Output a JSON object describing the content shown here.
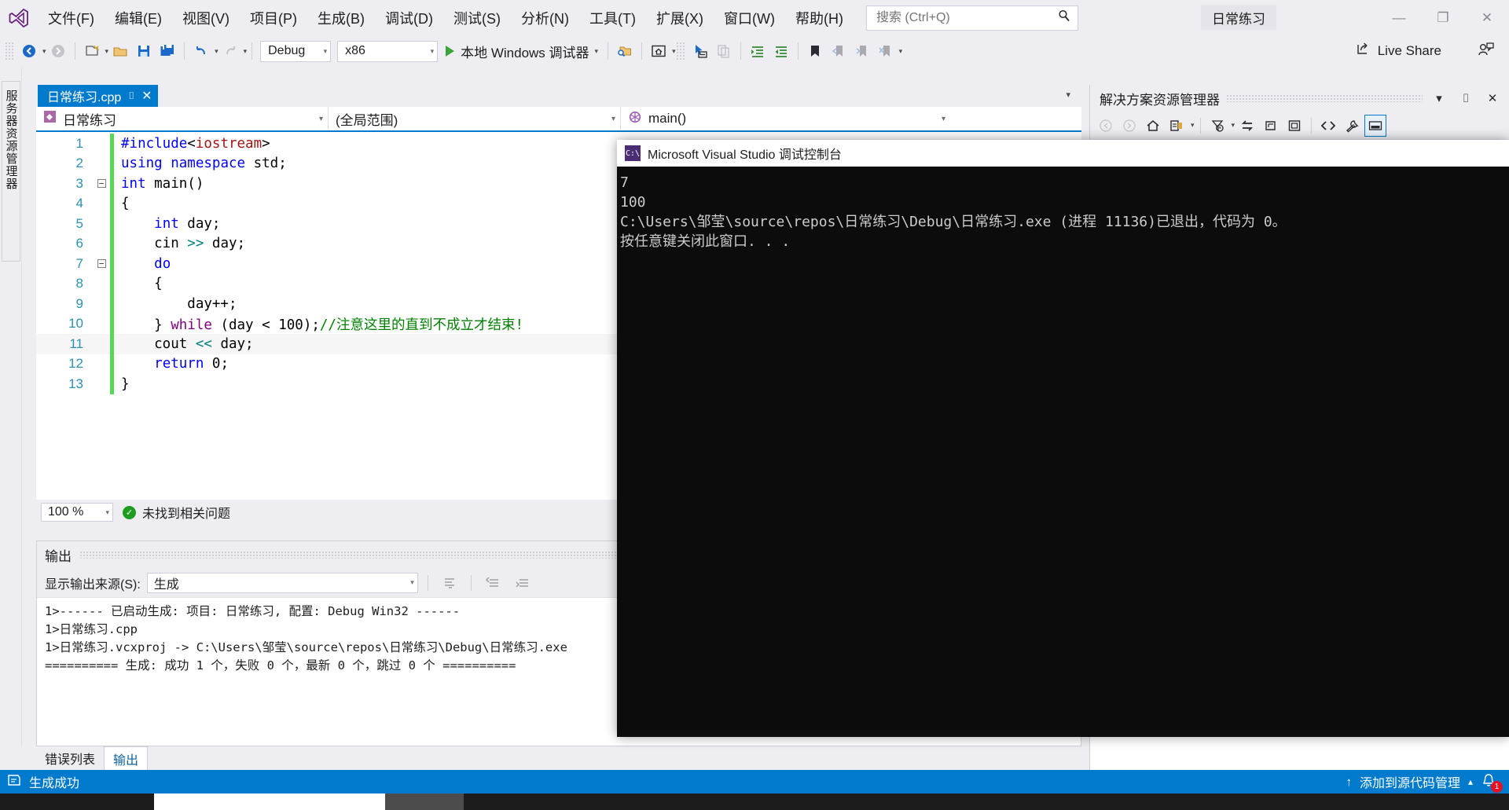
{
  "titlebar": {
    "logo_icon": "visual-studio-logo",
    "menus": [
      {
        "label": "文件(F)"
      },
      {
        "label": "编辑(E)"
      },
      {
        "label": "视图(V)"
      },
      {
        "label": "项目(P)"
      },
      {
        "label": "生成(B)"
      },
      {
        "label": "调试(D)"
      },
      {
        "label": "测试(S)"
      },
      {
        "label": "分析(N)"
      },
      {
        "label": "工具(T)"
      },
      {
        "label": "扩展(X)"
      },
      {
        "label": "窗口(W)"
      },
      {
        "label": "帮助(H)"
      }
    ],
    "search_placeholder": "搜索 (Ctrl+Q)",
    "search_value": "",
    "search_icon": "search-icon",
    "project_title": "日常练习",
    "minimize": "—",
    "maximize": "❐",
    "close": "✕"
  },
  "toolbar": {
    "nav_back_icon": "navigate-back-icon",
    "nav_forward_icon": "navigate-forward-icon",
    "new_project_icon": "new-project-icon",
    "open_file_icon": "open-file-icon",
    "save_icon": "save-icon",
    "save_all_icon": "save-all-icon",
    "undo_icon": "undo-icon",
    "redo_icon": "redo-icon",
    "configuration": "Debug",
    "platform": "x86",
    "run_label": "本地 Windows 调试器",
    "run_icon": "play-icon",
    "find_in_files_icon": "find-in-files-icon",
    "home_icon": "home-window-icon",
    "select_icon": "pointer-select-icon",
    "copy_icon": "copy-icon",
    "indent_icon": "increase-indent-icon",
    "outdent_icon": "decrease-indent-icon",
    "bookmark_icon": "bookmark-icon",
    "prev_bookmark_icon": "previous-bookmark-icon",
    "next_bookmark_icon": "next-bookmark-icon",
    "clear_bookmark_icon": "clear-bookmark-icon",
    "live_share_label": "Live Share",
    "live_share_icon": "share-icon",
    "feedback_icon": "feedback-person-icon"
  },
  "left_rail": {
    "server_explorer_label": "服务器资源管理器"
  },
  "editor": {
    "tab_name": "日常练习.cpp",
    "tab_pin_icon": "pin-icon",
    "tab_close_icon": "close-icon",
    "tabstrip_caret_icon": "chevron-down-icon",
    "nav_project": "日常练习",
    "nav_project_icon": "cpp-project-icon",
    "nav_scope": "(全局范围)",
    "nav_function": "main()",
    "nav_function_icon": "method-icon",
    "zoom_level": "100 %",
    "issue_status": "未找到相关问题",
    "issue_icon": "check-circle-icon",
    "lines": [
      {
        "n": "1",
        "fold": "",
        "changed": true,
        "tokens": [
          {
            "t": "#include",
            "c": "k-blue"
          },
          {
            "t": "<",
            "c": "k-plain"
          },
          {
            "t": "iostream",
            "c": "k-red"
          },
          {
            "t": ">",
            "c": "k-plain"
          }
        ]
      },
      {
        "n": "2",
        "fold": "",
        "changed": true,
        "tokens": [
          {
            "t": "using",
            "c": "k-blue"
          },
          {
            "t": " ",
            "c": "k-plain"
          },
          {
            "t": "namespace",
            "c": "k-blue"
          },
          {
            "t": " std;",
            "c": "k-plain"
          }
        ]
      },
      {
        "n": "3",
        "fold": "−",
        "changed": true,
        "tokens": [
          {
            "t": "int",
            "c": "k-blue"
          },
          {
            "t": " main()",
            "c": "k-plain"
          }
        ]
      },
      {
        "n": "4",
        "fold": "",
        "changed": true,
        "tokens": [
          {
            "t": "{",
            "c": "k-plain"
          }
        ]
      },
      {
        "n": "5",
        "fold": "",
        "changed": true,
        "tokens": [
          {
            "t": "    ",
            "c": "k-plain"
          },
          {
            "t": "int",
            "c": "k-blue"
          },
          {
            "t": " day;",
            "c": "k-plain"
          }
        ]
      },
      {
        "n": "6",
        "fold": "",
        "changed": true,
        "tokens": [
          {
            "t": "    cin ",
            "c": "k-plain"
          },
          {
            "t": ">>",
            "c": "k-op"
          },
          {
            "t": " day;",
            "c": "k-plain"
          }
        ]
      },
      {
        "n": "7",
        "fold": "−",
        "changed": true,
        "tokens": [
          {
            "t": "    ",
            "c": "k-plain"
          },
          {
            "t": "do",
            "c": "k-blue"
          }
        ]
      },
      {
        "n": "8",
        "fold": "",
        "changed": true,
        "tokens": [
          {
            "t": "    {",
            "c": "k-plain"
          }
        ]
      },
      {
        "n": "9",
        "fold": "",
        "changed": true,
        "tokens": [
          {
            "t": "        day++;",
            "c": "k-plain"
          }
        ]
      },
      {
        "n": "10",
        "fold": "",
        "changed": true,
        "tokens": [
          {
            "t": "    } ",
            "c": "k-plain"
          },
          {
            "t": "while",
            "c": "k-purple"
          },
          {
            "t": " (day ",
            "c": "k-plain"
          },
          {
            "t": "<",
            "c": "k-plain"
          },
          {
            "t": " 100);",
            "c": "k-plain"
          },
          {
            "t": "//注意这里的直到不成立才结束!",
            "c": "k-green"
          }
        ]
      },
      {
        "n": "11",
        "fold": "",
        "changed": true,
        "current": true,
        "tokens": [
          {
            "t": "    cout ",
            "c": "k-plain"
          },
          {
            "t": "<<",
            "c": "k-op"
          },
          {
            "t": " day;",
            "c": "k-plain"
          }
        ]
      },
      {
        "n": "12",
        "fold": "",
        "changed": true,
        "tokens": [
          {
            "t": "    ",
            "c": "k-plain"
          },
          {
            "t": "return",
            "c": "k-blue"
          },
          {
            "t": " 0;",
            "c": "k-plain"
          }
        ]
      },
      {
        "n": "13",
        "fold": "",
        "changed": true,
        "tokens": [
          {
            "t": "}",
            "c": "k-plain"
          }
        ]
      }
    ]
  },
  "output": {
    "pane_title": "输出",
    "source_label": "显示输出来源(S):",
    "source_value": "生成",
    "find_icon": "find-message-icon",
    "go_to_prev_icon": "go-to-previous-message-icon",
    "go_to_next_icon": "go-to-next-message-icon",
    "lines": [
      "1>------ 已启动生成: 项目: 日常练习, 配置: Debug Win32 ------",
      "1>日常练习.cpp",
      "1>日常练习.vcxproj -> C:\\Users\\邹莹\\source\\repos\\日常练习\\Debug\\日常练习.exe",
      "========== 生成: 成功 1 个，失败 0 个，最新 0 个，跳过 0 个 =========="
    ]
  },
  "bottom_tabs": [
    {
      "label": "错误列表",
      "active": false
    },
    {
      "label": "输出",
      "active": true
    }
  ],
  "solution_explorer": {
    "title": "解决方案资源管理器",
    "dropdown_icon": "chevron-down-icon",
    "pin_icon": "pin-icon",
    "close_icon": "close-icon",
    "toolbar_icons": [
      {
        "name": "back-icon",
        "glyph": "◐",
        "disabled": true
      },
      {
        "name": "forward-icon",
        "glyph": "◑",
        "disabled": true
      },
      {
        "name": "home-icon",
        "glyph": "⌂",
        "disabled": false
      },
      {
        "name": "properties-window-icon",
        "glyph": "▣",
        "disabled": false
      },
      {
        "name": "properties-dropdown-icon",
        "glyph": "▾",
        "disabled": false
      },
      {
        "name": "pending-changes-filter-icon",
        "glyph": "◔",
        "disabled": false
      },
      {
        "name": "filter-dropdown-icon",
        "glyph": "▾",
        "disabled": false
      },
      {
        "name": "sync-with-active-document-icon",
        "glyph": "⇄",
        "disabled": false
      },
      {
        "name": "refresh-icon",
        "glyph": "⟳",
        "disabled": false
      },
      {
        "name": "collapse-all-icon",
        "glyph": "⊟",
        "disabled": false
      },
      {
        "name": "show-all-files-icon",
        "glyph": "<>",
        "disabled": false
      },
      {
        "name": "view-properties-icon",
        "glyph": "🔧",
        "disabled": false
      },
      {
        "name": "preview-selected-items-icon",
        "glyph": "▬",
        "disabled": false,
        "selected": true
      }
    ]
  },
  "console": {
    "title": "Microsoft Visual Studio 调试控制台",
    "icon": "console-app-icon",
    "icon_text": "C:\\",
    "lines": [
      "7",
      "100",
      "C:\\Users\\邹莹\\source\\repos\\日常练习\\Debug\\日常练习.exe (进程 11136)已退出，代码为 0。",
      "按任意键关闭此窗口. . ."
    ]
  },
  "status_bar": {
    "icon": "build-status-icon",
    "text": "生成成功",
    "source_control_label": "添加到源代码管理",
    "source_control_up_icon": "arrow-up-icon",
    "source_control_caret_icon": "chevron-up-icon",
    "notification_icon": "bell-icon",
    "notification_count": "1"
  }
}
